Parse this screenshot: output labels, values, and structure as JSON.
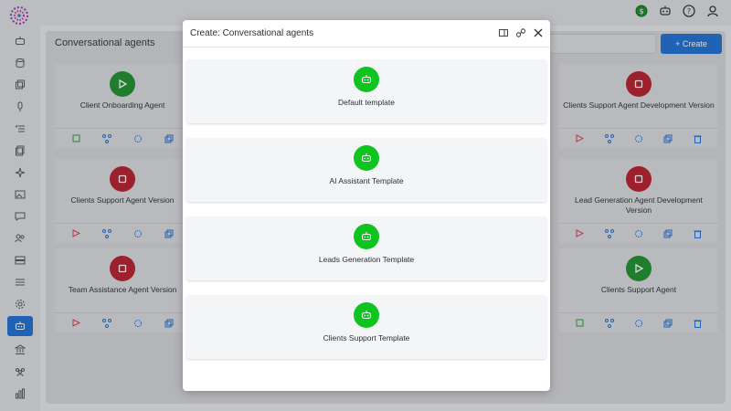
{
  "header": {
    "icons": [
      "dollar-icon",
      "robot-icon",
      "help-icon",
      "user-icon"
    ],
    "accent": "#10c41f"
  },
  "sidebar": {
    "items": [
      "robot-icon",
      "database-icon",
      "layers-icon",
      "microphone-icon",
      "checklist-icon",
      "copy-icon",
      "sparkle-icon",
      "image-icon",
      "chat-icon",
      "users-icon",
      "server-icon",
      "menu-icon",
      "gear-icon",
      "agent-icon",
      "bank-icon",
      "group-icon",
      "chart-icon"
    ],
    "active_index": 13
  },
  "main": {
    "title": "Conversational agents",
    "create_label": "+ Create",
    "cards": [
      {
        "name": "Client Onboarding Agent",
        "status": "green"
      },
      {
        "name": "Clients Support Agent Development Version",
        "status": "red"
      },
      {
        "name": "Clients Support Agent Version",
        "status": "red"
      },
      {
        "name": "Lead Generation Agent Development Version",
        "status": "red"
      },
      {
        "name": "Team Assistance Agent Version",
        "status": "red"
      },
      {
        "name": "Clients Support Agent",
        "status": "green"
      }
    ]
  },
  "modal": {
    "title": "Create: Conversational agents",
    "templates": [
      {
        "label": "Default template"
      },
      {
        "label": "AI Assistant Template"
      },
      {
        "label": "Leads Generation Template"
      },
      {
        "label": "Clients Support Template"
      }
    ]
  },
  "colors": {
    "primary": "#1f6fd1",
    "green": "#10c41f",
    "red": "#e0313f"
  }
}
